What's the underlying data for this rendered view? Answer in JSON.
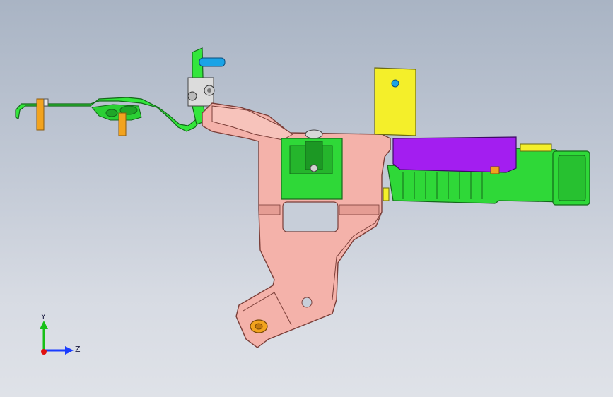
{
  "viewport": {
    "background_top": "#a9b4c4",
    "background_bottom": "#dfe2e8"
  },
  "model": {
    "colors": {
      "bracket_main": "#f4b2aa",
      "bracket_outline": "#7a3e38",
      "harness_green": "#33e63c",
      "harness_outline": "#14681a",
      "connector_green": "#2fd838",
      "housing_purple": "#a31ef0",
      "plate_yellow": "#f4ef2a",
      "pin_blue": "#1aa3e6",
      "pin_orange": "#f2a31e",
      "bolt_gray": "#c8c8c8"
    }
  },
  "triad": {
    "y_label": "Y",
    "z_label": "Z",
    "y_color": "#18c018",
    "z_color": "#1a3cff",
    "x_color": "#e01010"
  }
}
